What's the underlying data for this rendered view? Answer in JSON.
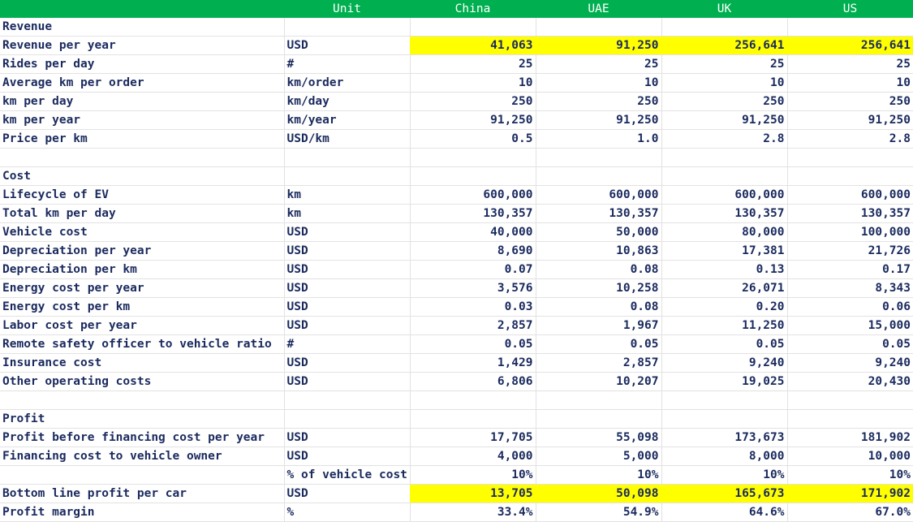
{
  "header": {
    "label": "",
    "unit": "Unit",
    "countries": [
      "China",
      "UAE",
      "UK",
      "US"
    ]
  },
  "rows": [
    {
      "type": "section",
      "label": "Revenue"
    },
    {
      "type": "data",
      "label": "Revenue per year",
      "unit": "USD",
      "values": [
        "41,063",
        "91,250",
        "256,641",
        "256,641"
      ],
      "highlight": true
    },
    {
      "type": "data",
      "label": "Rides per day",
      "unit": "#",
      "values": [
        "25",
        "25",
        "25",
        "25"
      ]
    },
    {
      "type": "data",
      "label": "Average km per order",
      "unit": "km/order",
      "values": [
        "10",
        "10",
        "10",
        "10"
      ]
    },
    {
      "type": "data",
      "label": "km per day",
      "unit": "km/day",
      "values": [
        "250",
        "250",
        "250",
        "250"
      ]
    },
    {
      "type": "data",
      "label": "km per year",
      "unit": "km/year",
      "values": [
        "91,250",
        "91,250",
        "91,250",
        "91,250"
      ]
    },
    {
      "type": "data",
      "label": "Price per km",
      "unit": "USD/km",
      "values": [
        "0.5",
        "1.0",
        "2.8",
        "2.8"
      ]
    },
    {
      "type": "blank"
    },
    {
      "type": "section",
      "label": "Cost",
      "rule": true
    },
    {
      "type": "data",
      "label": "Lifecycle of EV",
      "unit": "km",
      "values": [
        "600,000",
        "600,000",
        "600,000",
        "600,000"
      ]
    },
    {
      "type": "data",
      "label": "Total km per day",
      "unit": "km",
      "values": [
        "130,357",
        "130,357",
        "130,357",
        "130,357"
      ]
    },
    {
      "type": "data",
      "label": "Vehicle cost",
      "unit": "USD",
      "values": [
        "40,000",
        "50,000",
        "80,000",
        "100,000"
      ]
    },
    {
      "type": "data",
      "label": "Depreciation per year",
      "unit": "USD",
      "values": [
        "8,690",
        "10,863",
        "17,381",
        "21,726"
      ]
    },
    {
      "type": "data",
      "label": "Depreciation per km",
      "unit": "USD",
      "values": [
        "0.07",
        "0.08",
        "0.13",
        "0.17"
      ]
    },
    {
      "type": "data",
      "label": "Energy cost per year",
      "unit": "USD",
      "values": [
        "3,576",
        "10,258",
        "26,071",
        "8,343"
      ]
    },
    {
      "type": "data",
      "label": "Energy cost per km",
      "unit": "USD",
      "values": [
        "0.03",
        "0.08",
        "0.20",
        "0.06"
      ]
    },
    {
      "type": "data",
      "label": "Labor cost per year",
      "unit": "USD",
      "values": [
        "2,857",
        "1,967",
        "11,250",
        "15,000"
      ]
    },
    {
      "type": "data",
      "label": "Remote safety officer to vehicle ratio",
      "unit": "#",
      "values": [
        "0.05",
        "0.05",
        "0.05",
        "0.05"
      ]
    },
    {
      "type": "data",
      "label": "Insurance cost",
      "unit": "USD",
      "values": [
        "1,429",
        "2,857",
        "9,240",
        "9,240"
      ]
    },
    {
      "type": "data",
      "label": "Other operating costs",
      "unit": "USD",
      "values": [
        "6,806",
        "10,207",
        "19,025",
        "20,430"
      ]
    },
    {
      "type": "blank"
    },
    {
      "type": "section",
      "label": "Profit",
      "rule": true
    },
    {
      "type": "data",
      "label": "Profit before financing cost per year",
      "unit": "USD",
      "values": [
        "17,705",
        "55,098",
        "173,673",
        "181,902"
      ]
    },
    {
      "type": "data",
      "label": "Financing cost to vehicle owner",
      "unit": "USD",
      "values": [
        "4,000",
        "5,000",
        "8,000",
        "10,000"
      ]
    },
    {
      "type": "data",
      "label": "",
      "unit": "% of vehicle cost",
      "values": [
        "10%",
        "10%",
        "10%",
        "10%"
      ]
    },
    {
      "type": "data",
      "label": "Bottom line profit per car",
      "unit": "USD",
      "values": [
        "13,705",
        "50,098",
        "165,673",
        "171,902"
      ],
      "highlight": true
    },
    {
      "type": "data",
      "label": "Profit margin",
      "unit": "%",
      "values": [
        "33.4%",
        "54.9%",
        "64.6%",
        "67.0%"
      ]
    }
  ],
  "colors": {
    "header_bg": "#00b050",
    "highlight": "#ffff00",
    "text": "#1a2a5e"
  }
}
